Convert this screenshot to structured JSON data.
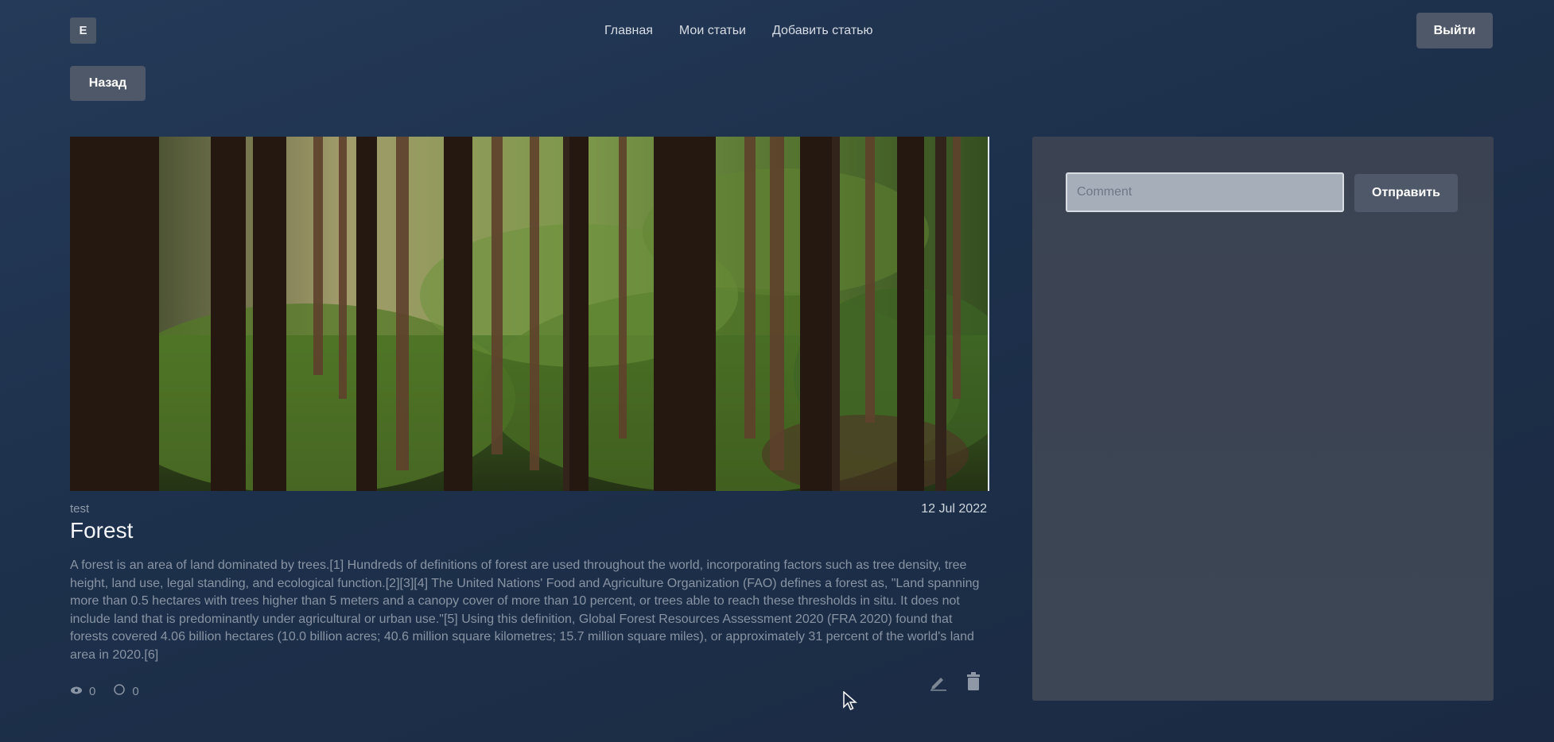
{
  "header": {
    "logo_letter": "E",
    "nav": [
      "Главная",
      "Мои статьи",
      "Добавить статью"
    ],
    "logout_label": "Выйти"
  },
  "back_label": "Назад",
  "article": {
    "author": "test",
    "date": "12 Jul 2022",
    "title": "Forest",
    "body": "A forest is an area of land dominated by trees.[1] Hundreds of definitions of forest are used throughout the world, incorporating factors such as tree density, tree height, land use, legal standing, and ecological function.[2][3][4] The United Nations' Food and Agriculture Organization (FAO) defines a forest as, \"Land spanning more than 0.5 hectares with trees higher than 5 meters and a canopy cover of more than 10 percent, or trees able to reach these thresholds in situ. It does not include land that is predominantly under agricultural or urban use.\"[5] Using this definition, Global Forest Resources Assessment 2020 (FRA 2020) found that forests covered 4.06 billion hectares (10.0 billion acres; 40.6 million square kilometres; 15.7 million square miles), or approximately 31 percent of the world's land area in 2020.[6]",
    "views": "0",
    "comments_count": "0"
  },
  "comments": {
    "placeholder": "Comment",
    "value": "",
    "send_label": "Отправить"
  },
  "icons": {
    "views": "eye-icon",
    "comments": "comment-icon",
    "edit": "pencil-icon",
    "delete": "trash-icon"
  },
  "colors": {
    "background": "#1f3250",
    "button": "#4e5868",
    "panel": "#3c4454"
  }
}
